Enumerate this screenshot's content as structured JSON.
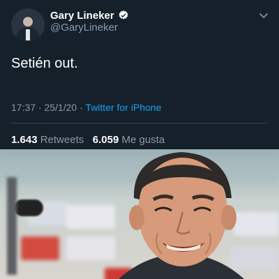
{
  "tweet": {
    "author_name": "Gary Lineker",
    "author_handle": "@GaryLineker",
    "text": "Setién out.",
    "time": "17:37",
    "date": "25/1/20",
    "separator": "·",
    "source": "Twitter for iPhone",
    "retweets_count": "1.643",
    "retweets_label": "Retweets",
    "likes_count": "6.059",
    "likes_label": "Me gusta",
    "verified_icon": "verified-badge-icon",
    "menu_icon": "chevron-down-icon"
  },
  "colors": {
    "background": "#15202b",
    "text_primary": "#ffffff",
    "text_secondary": "#8899a6",
    "link": "#1da1f2",
    "divider": "#38444d"
  }
}
